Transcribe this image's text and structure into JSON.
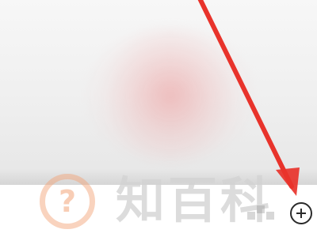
{
  "watermark": {
    "brand_text": "知百科",
    "logo_icon": "question-mark-circle-icon",
    "logo_color": "#f3a478"
  },
  "zoom_button": {
    "icon": "zoom-in-plus-icon",
    "color": "#2b2b2b"
  },
  "annotation": {
    "icon": "red-pointer-arrow",
    "color": "#e8332b"
  }
}
